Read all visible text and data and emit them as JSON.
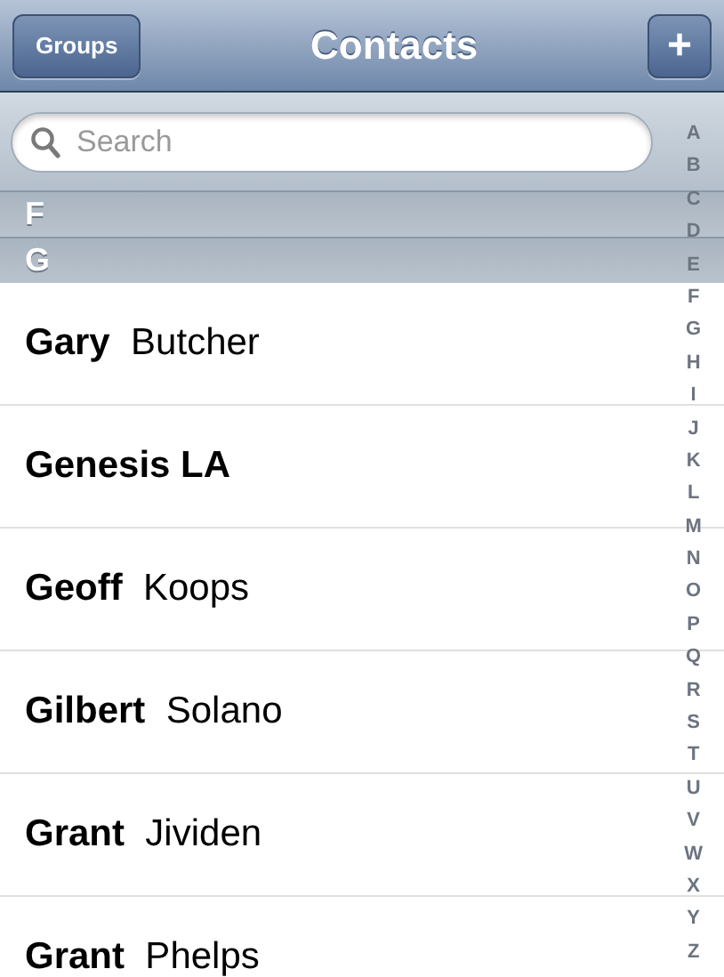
{
  "nav_bar": {
    "title": "Contacts",
    "left_button": "Groups",
    "right_button": "+"
  },
  "search": {
    "placeholder": "Search"
  },
  "sections": [
    {
      "header": "F"
    },
    {
      "header": "G",
      "contacts": [
        {
          "first": "Gary",
          "last": "Butcher"
        },
        {
          "first": "Genesis LA"
        },
        {
          "first": "Geoff",
          "last": "Koops"
        },
        {
          "first": "Gilbert",
          "last": "Solano"
        },
        {
          "first": "Grant",
          "last": "Jividen"
        },
        {
          "first": "Grant",
          "last": "Phelps"
        }
      ]
    }
  ],
  "index": [
    "A",
    "B",
    "C",
    "D",
    "E",
    "F",
    "G",
    "H",
    "I",
    "J",
    "K",
    "L",
    "M",
    "N",
    "O",
    "P",
    "Q",
    "R",
    "S",
    "T",
    "U",
    "V",
    "W",
    "X",
    "Y",
    "Z"
  ]
}
